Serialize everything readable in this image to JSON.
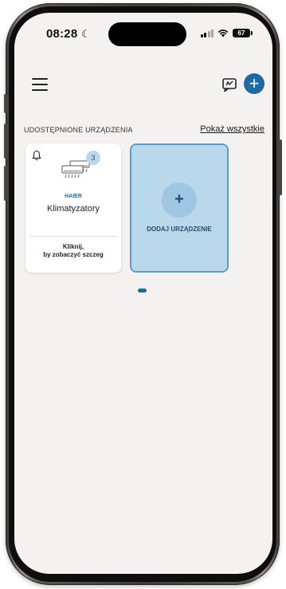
{
  "status_bar": {
    "time": "08:28",
    "battery": "67",
    "icons": [
      "moon-icon",
      "signal-icon",
      "wifi-icon",
      "battery-icon"
    ]
  },
  "header": {
    "icons": [
      "menu-icon",
      "message-icon",
      "add-icon"
    ]
  },
  "section": {
    "title": "UDOSTĘPNIONE URZĄDZENIA",
    "show_all": "Pokaż wszystkie"
  },
  "device_card": {
    "badge_count": "3",
    "brand": "HAIER",
    "name": "Klimatyzatory",
    "cta_line1": "Kliknij,",
    "cta_line2": "by zobaczyć szczeg"
  },
  "add_card": {
    "plus": "+",
    "label": "DODAJ URZĄDZENIE"
  },
  "colors": {
    "accent": "#1d6aa1",
    "add_card_bg": "#b9d8ec",
    "add_card_border": "#5a9ccb",
    "screen_bg": "#f4f2f0"
  },
  "pager": {
    "pages": 1,
    "active": 1
  }
}
